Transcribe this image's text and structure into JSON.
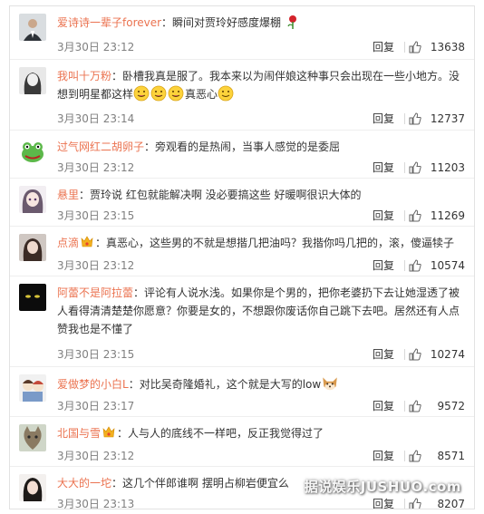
{
  "comments": [
    {
      "user": "爱诗诗一辈子forever",
      "vip": false,
      "text": "：瞬间对贾玲好感度爆棚",
      "time": "3月30日 23:12",
      "reply": "回复",
      "likes": "13638",
      "avatar": "avatar-man-suit",
      "decoration": "rose-icon"
    },
    {
      "user": "我叫十万粉",
      "vip": false,
      "text_a": "：卧槽我真是服了。我本来以为闹伴娘这种事只会出现在一些小地方。没想到明星都这样",
      "text_b": "真恶心",
      "time": "3月30日 23:14",
      "reply": "回复",
      "likes": "12737",
      "avatar": "avatar-woman-bw"
    },
    {
      "user": "过气网红二胡卵子",
      "vip": false,
      "text": "：旁观看的是热闹，当事人感觉的是委屈",
      "time": "3月30日 23:12",
      "reply": "回复",
      "likes": "11203",
      "avatar": "avatar-frog"
    },
    {
      "user": "悬里",
      "vip": false,
      "text": "：贾玲说 红包就能解决啊 没必要搞这些 好暖啊很识大体的",
      "time": "3月30日 23:15",
      "reply": "回复",
      "likes": "11269",
      "avatar": "avatar-anime-girl"
    },
    {
      "user": "点滴",
      "vip": true,
      "text": "：真恶心，这些男的不就是想揩几把油吗？我揩你吗几把的，滚，傻逼犊子",
      "time": "3月30日 23:12",
      "reply": "回复",
      "likes": "10574",
      "avatar": "avatar-girl-photo"
    },
    {
      "user": "阿蕾不是阿拉蕾",
      "vip": false,
      "text": "：评论有人说水浅。如果你是个男的，把你老婆扔下去让她湿透了被人看得清清楚楚你愿意？你要是女的，不想跟你废话你自己跳下去吧。居然还有人点赞我也是不懂了",
      "time": "3月30日 23:15",
      "reply": "回复",
      "likes": "10274",
      "avatar": "avatar-dark-cat"
    },
    {
      "user": "爱做梦的小白L",
      "vip": false,
      "text": "：对比吴奇隆婚礼，这个就是大写的low",
      "time": "3月30日 23:17",
      "reply": "回复",
      "likes": "9572",
      "avatar": "avatar-cartoon-couple",
      "decoration": "shiba-dog-icon"
    },
    {
      "user": "北国与雪",
      "vip": true,
      "text": "：人与人的底线不一样吧，反正我觉得过了",
      "time": "3月30日 23:12",
      "reply": "回复",
      "likes": "8571",
      "avatar": "avatar-cat"
    },
    {
      "user": "大大的一坨",
      "vip": false,
      "text": "：这几个伴郎谁啊 摆明占柳岩便宜么",
      "time": "3月30日 23:13",
      "reply": "回复",
      "likes": "8207",
      "avatar": "avatar-girl-portrait"
    }
  ],
  "watermark": "据说娱乐JUSHUO.com",
  "colors": {
    "username": "#eb7350",
    "text": "#333333",
    "meta": "#808080",
    "border": "#e2e2e2"
  }
}
